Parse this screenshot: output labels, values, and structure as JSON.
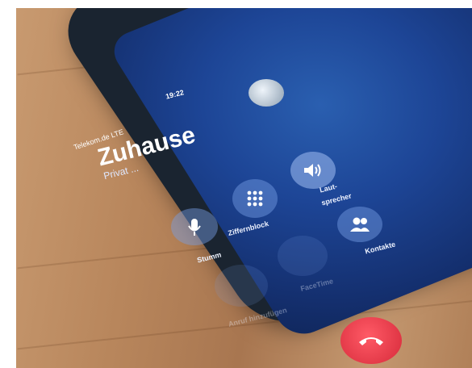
{
  "status": {
    "carrier": "Telekom.de LTE",
    "time": "19:22"
  },
  "call": {
    "caller_name": "Zuhause",
    "caller_sub": "Privat ..."
  },
  "buttons": {
    "mute_label": "Stumm",
    "keypad_label": "Ziffernblock",
    "speaker_label_line1": "Laut-",
    "speaker_label_line2": "sprecher",
    "contacts_label": "Kontakte",
    "add_call_label": "Anruf hinzufügen",
    "facetime_label": "FaceTime"
  },
  "icons": {
    "mute": "mute-icon",
    "keypad": "keypad-icon",
    "speaker": "speaker-icon",
    "contacts": "contacts-icon",
    "end_call": "end-call-icon"
  },
  "colors": {
    "end_call": "#e0303f",
    "screen_blue": "#1d4596"
  }
}
